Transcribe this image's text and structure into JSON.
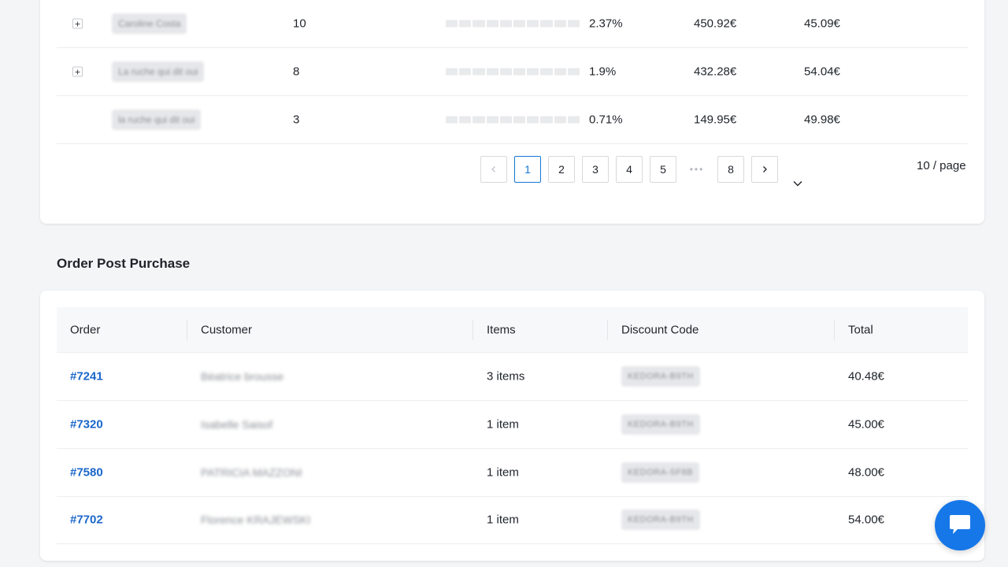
{
  "affiliates": {
    "rows": [
      {
        "name": "Caroline Costa",
        "count": "10",
        "pct": "2.37%",
        "total": "450.92€",
        "avg": "45.09€",
        "expandable": true
      },
      {
        "name": "La ruche qui dit oui",
        "count": "8",
        "pct": "1.9%",
        "total": "432.28€",
        "avg": "54.04€",
        "expandable": true
      },
      {
        "name": "la ruche qui dit oui",
        "count": "3",
        "pct": "0.71%",
        "total": "149.95€",
        "avg": "49.98€",
        "expandable": false
      }
    ],
    "pagination": {
      "pages": [
        "1",
        "2",
        "3",
        "4",
        "5",
        "8"
      ],
      "ellipsis": "•••",
      "current": "1",
      "page_size": "10 / page"
    }
  },
  "orders_section": {
    "title": "Order Post Purchase",
    "columns": [
      "Order",
      "Customer",
      "Items",
      "Discount Code",
      "Total"
    ],
    "rows": [
      {
        "order": "#7241",
        "customer": "Béatrice brousse",
        "items": "3 items",
        "code": "KEDORA-B9TH",
        "total": "40.48€"
      },
      {
        "order": "#7320",
        "customer": "Isabelle Saisof",
        "items": "1 item",
        "code": "KEDORA-B9TH",
        "total": "45.00€"
      },
      {
        "order": "#7580",
        "customer": "PATRICIA MAZZONI",
        "items": "1 item",
        "code": "KEDORA-SF8B",
        "total": "48.00€"
      },
      {
        "order": "#7702",
        "customer": "Florence KRAJEWSKI",
        "items": "1 item",
        "code": "KEDORA-B9TH",
        "total": "54.00€"
      }
    ]
  },
  "colors": {
    "accent": "#1677d2",
    "link": "#1a66c9",
    "chat_button": "#1677e8"
  }
}
